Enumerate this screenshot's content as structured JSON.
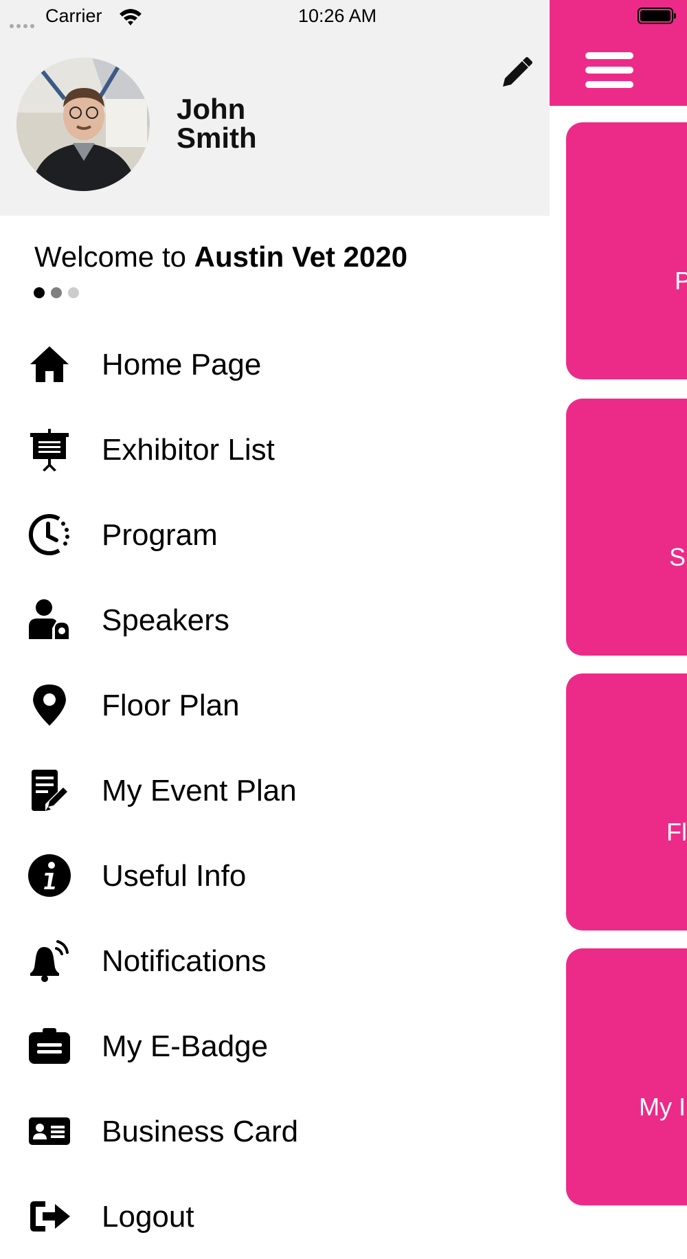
{
  "status_bar": {
    "carrier": "Carrier",
    "time": "10:26 AM"
  },
  "profile": {
    "first_name": "John",
    "last_name": "Smith"
  },
  "welcome": {
    "prefix": "Welcome to ",
    "event_name": "Austin Vet 2020"
  },
  "carousel": {
    "dot_colors": [
      "#000000",
      "#808080",
      "#cccccc"
    ]
  },
  "menu": {
    "items": [
      {
        "label": "Home Page",
        "icon": "home-icon"
      },
      {
        "label": "Exhibitor List",
        "icon": "presentation-board-icon"
      },
      {
        "label": "Program",
        "icon": "clock-icon"
      },
      {
        "label": "Speakers",
        "icon": "speaker-icon"
      },
      {
        "label": "Floor Plan",
        "icon": "map-pin-icon"
      },
      {
        "label": "My Event Plan",
        "icon": "document-edit-icon"
      },
      {
        "label": "Useful Info",
        "icon": "info-icon"
      },
      {
        "label": "Notifications",
        "icon": "bell-icon"
      },
      {
        "label": "My E-Badge",
        "icon": "badge-icon"
      },
      {
        "label": "Business Card",
        "icon": "id-card-icon"
      },
      {
        "label": "Logout",
        "icon": "logout-icon"
      }
    ]
  },
  "background_tiles": [
    "P",
    "S",
    "Fl",
    "My I"
  ],
  "colors": {
    "accent": "#ec2b89",
    "profile_bg": "#f1f1f1"
  }
}
